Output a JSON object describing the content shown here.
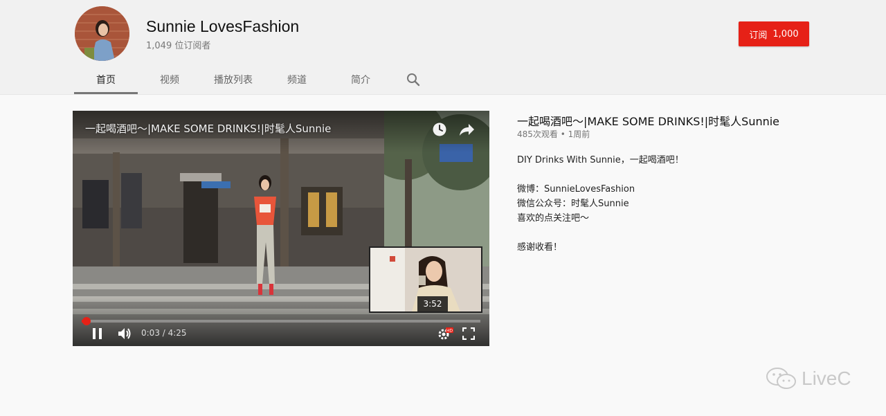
{
  "channel": {
    "name": "Sunnie LovesFashion",
    "subscribers": "1,049 位订阅者",
    "subscribe_label": "订阅",
    "subscribe_count": "1,000"
  },
  "tabs": [
    {
      "label": "首页",
      "active": true
    },
    {
      "label": "视频"
    },
    {
      "label": "播放列表"
    },
    {
      "label": "频道"
    },
    {
      "label": "简介"
    }
  ],
  "player": {
    "overlay_title": "一起喝酒吧～|MAKE SOME DRINKS!|时髦人Sunnie",
    "thumbnail_duration": "3:52",
    "current_time": "0:03 / 4:25",
    "progress_fraction": 0.012,
    "accent_color": "#e62117",
    "icons": [
      "watch-later-icon",
      "share-icon",
      "pause-icon",
      "volume-icon",
      "settings-hd-icon",
      "fullscreen-icon"
    ]
  },
  "video": {
    "title": "一起喝酒吧～|MAKE SOME DRINKS!|时髦人Sunnie",
    "meta": "485次观看 • 1周前",
    "description": [
      "DIY Drinks With Sunnie，一起喝酒吧！",
      "微博：SunnieLovesFashion",
      "微信公众号：时髦人Sunnie",
      "喜欢的点关注吧～",
      "感谢收看！"
    ]
  },
  "watermark": {
    "text": "LiveC"
  }
}
